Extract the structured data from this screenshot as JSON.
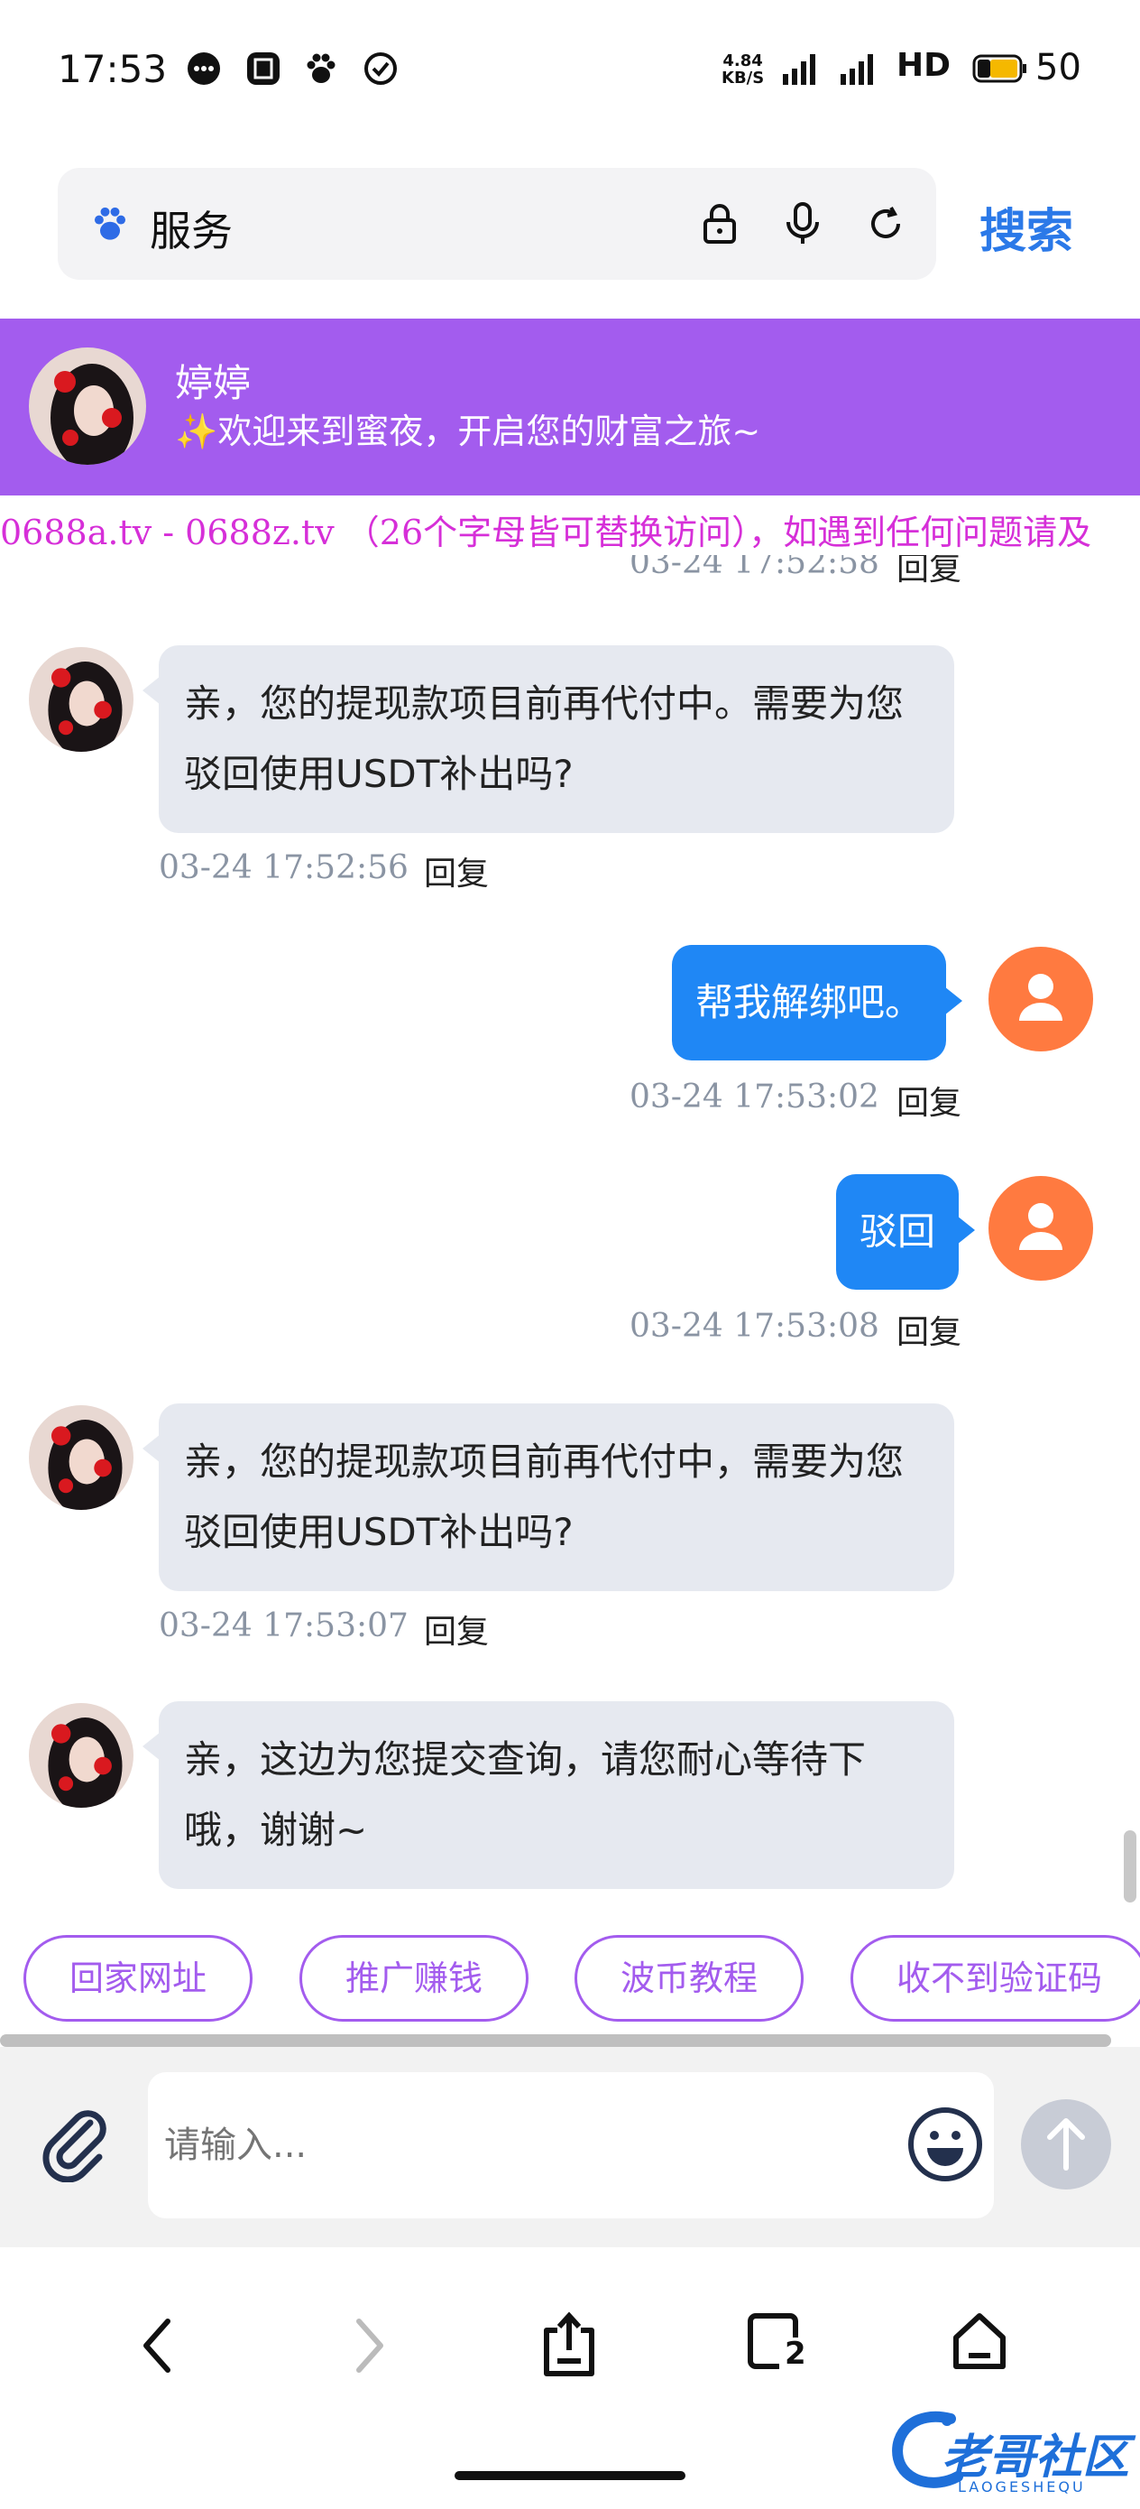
{
  "status_bar": {
    "time": "17:53",
    "net_speed_top": "4.84",
    "net_speed_bottom": "KB/S",
    "hd_label": "HD",
    "battery": "50",
    "icons": [
      "message-bubble-icon",
      "app-icon",
      "baidu-paw-icon",
      "check-circle-icon"
    ]
  },
  "address_bar": {
    "text": "服务",
    "search_label": "搜索",
    "icons": [
      "baidu-paw-icon",
      "lock-icon",
      "microphone-icon",
      "refresh-icon"
    ]
  },
  "chat_header": {
    "name": "婷婷",
    "greeting": "✨欢迎来到蜜夜，开启您的财富之旅~"
  },
  "marquee": {
    "text": "0688a.tv - 0688z.tv （26个字母皆可替换访问），如遇到任何问题请及"
  },
  "messages": [
    {
      "side": "in",
      "text": "",
      "time": "03-24 17:52:58",
      "reply": "回复"
    },
    {
      "side": "in",
      "text": "亲，您的提现款项目前再代付中。需要为您驳回使用USDT补出吗?",
      "time": "03-24 17:52:56",
      "reply": "回复"
    },
    {
      "side": "out",
      "text": "帮我解绑吧。",
      "time": "03-24 17:53:02",
      "reply": "回复"
    },
    {
      "side": "out",
      "text": "驳回",
      "time": "03-24 17:53:08",
      "reply": "回复"
    },
    {
      "side": "in",
      "text": "亲，您的提现款项目前再代付中，需要为您驳回使用USDT补出吗?",
      "time": "03-24 17:53:07",
      "reply": "回复"
    },
    {
      "side": "in",
      "text": "亲，这边为您提交查询，请您耐心等待下哦，谢谢~",
      "time": "",
      "reply": ""
    }
  ],
  "quick_replies": [
    "回家网址",
    "推广赚钱",
    "波币教程",
    "收不到验证码"
  ],
  "input": {
    "placeholder": "请输入..."
  },
  "colors": {
    "header_purple": "#a35cee",
    "outgoing_bubble": "#1f87f5",
    "incoming_bubble": "#e6e9f0",
    "user_avatar": "#ff7a40",
    "marquee_text": "#d62fd8",
    "search_blue": "#2b79e8"
  },
  "bottom_nav": {
    "tab_count": "2",
    "icons": [
      "back-icon",
      "forward-icon",
      "share-icon",
      "tabs-icon",
      "home-icon"
    ]
  },
  "watermark": {
    "text": "老哥社区",
    "subtext": "LAOGESHEQU"
  }
}
